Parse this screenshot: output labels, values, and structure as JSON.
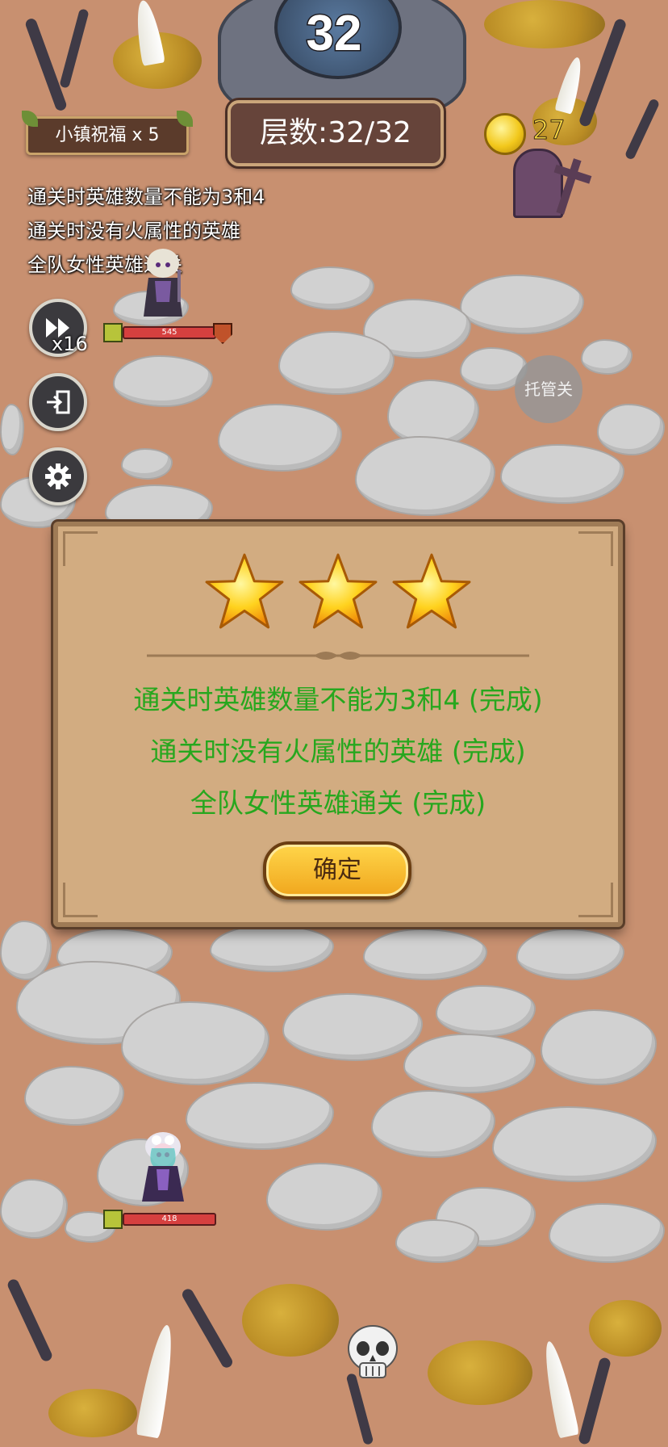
{
  "hud": {
    "round_number": "32",
    "blessing_label": "小镇祝福 x 5",
    "floor_label": "层数:32/32",
    "coin_count": "27"
  },
  "objectives": [
    "通关时英雄数量不能为3和4",
    "通关时没有火属性的英雄",
    "全队女性英雄通关"
  ],
  "controls": {
    "speed_label": "x16",
    "auto_label": "托管关"
  },
  "heroes": [
    {
      "hp": "545"
    },
    {
      "hp": "418"
    }
  ],
  "result_dialog": {
    "stars_earned": 3,
    "stars_total": 3,
    "lines": [
      "通关时英雄数量不能为3和4 (完成)",
      "通关时没有火属性的英雄 (完成)",
      "全队女性英雄通关 (完成)"
    ],
    "confirm_label": "确定"
  },
  "colors": {
    "success_text": "#27a71e",
    "coin_text": "#f4d442",
    "dialog_bg": "#d2ac81",
    "hp_bar": "#d6403f"
  }
}
